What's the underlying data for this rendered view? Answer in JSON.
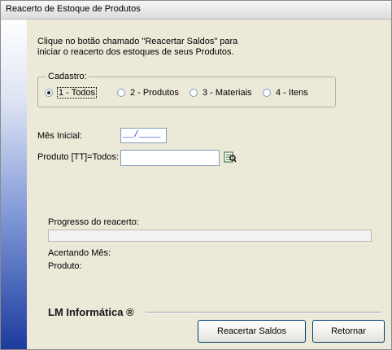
{
  "window": {
    "title": "Reacerto de Estoque de Produtos"
  },
  "intro": {
    "text": "Clique no botão chamado \"Reacertar Saldos\" para iniciar o reacerto dos estoques de seus Produtos."
  },
  "cadastro": {
    "legend": "Cadastro:",
    "options": [
      "1 - Todos",
      "2 - Produtos",
      "3 - Materiais",
      "4 - Itens"
    ],
    "selected": "1 - Todos"
  },
  "fields": {
    "mes_inicial_label": "Mês Inicial:",
    "mes_inicial_value": "__/____",
    "produto_label": "Produto [TT]=Todos:",
    "produto_value": ""
  },
  "progress": {
    "label": "Progresso do reacerto:",
    "value": 0,
    "acertando_mes_label": "Acertando Mês:",
    "produto_label": "Produto:"
  },
  "footer": {
    "brand": "LM Informática ®",
    "recalc_button": "Reacertar Saldos",
    "return_button": "Retornar"
  },
  "icons": {
    "lookup": "search-list-icon"
  }
}
